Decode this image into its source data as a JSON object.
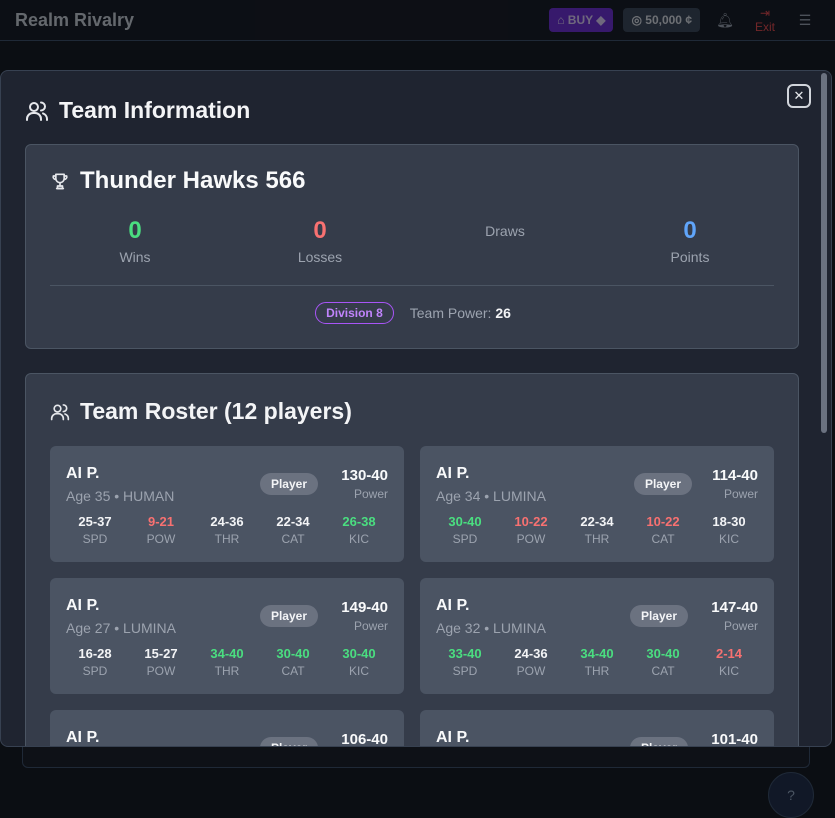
{
  "app": {
    "title": "Realm Rivalry",
    "buy_label": "BUY",
    "coins": "50,000",
    "exit_label": "Exit"
  },
  "modal": {
    "title": "Team Information",
    "close_icon": "close-icon"
  },
  "team": {
    "name": "Thunder Hawks 566",
    "stats": [
      {
        "value": "0",
        "label": "Wins",
        "color": "#4ade80"
      },
      {
        "value": "0",
        "label": "Losses",
        "color": "#f87171"
      },
      {
        "value": "",
        "label": "Draws",
        "color": "#9ca3af"
      },
      {
        "value": "0",
        "label": "Points",
        "color": "#60a5fa"
      }
    ],
    "division": "Division 8",
    "team_power_label": "Team Power:",
    "team_power_value": "26"
  },
  "roster": {
    "title": "Team Roster (12 players)",
    "stat_labels": [
      "SPD",
      "POW",
      "THR",
      "CAT",
      "KIC"
    ],
    "players": [
      {
        "name": "AI P.",
        "sub": "Age 35 • HUMAN",
        "tag": "Player",
        "rating": "130-40",
        "power_label": "Power",
        "stats": [
          [
            "25-37",
            "white"
          ],
          [
            "9-21",
            "red"
          ],
          [
            "24-36",
            "white"
          ],
          [
            "22-34",
            "white"
          ],
          [
            "26-38",
            "green"
          ]
        ]
      },
      {
        "name": "AI P.",
        "sub": "Age 34 • LUMINA",
        "tag": "Player",
        "rating": "114-40",
        "power_label": "Power",
        "stats": [
          [
            "30-40",
            "green"
          ],
          [
            "10-22",
            "red"
          ],
          [
            "22-34",
            "white"
          ],
          [
            "10-22",
            "red"
          ],
          [
            "18-30",
            "white"
          ]
        ]
      },
      {
        "name": "AI P.",
        "sub": "Age 27 • LUMINA",
        "tag": "Player",
        "rating": "149-40",
        "power_label": "Power",
        "stats": [
          [
            "16-28",
            "white"
          ],
          [
            "15-27",
            "white"
          ],
          [
            "34-40",
            "green"
          ],
          [
            "30-40",
            "green"
          ],
          [
            "30-40",
            "green"
          ]
        ]
      },
      {
        "name": "AI P.",
        "sub": "Age 32 • LUMINA",
        "tag": "Player",
        "rating": "147-40",
        "power_label": "Power",
        "stats": [
          [
            "33-40",
            "green"
          ],
          [
            "24-36",
            "white"
          ],
          [
            "34-40",
            "green"
          ],
          [
            "30-40",
            "green"
          ],
          [
            "2-14",
            "red"
          ]
        ]
      },
      {
        "name": "AI P.",
        "sub": "",
        "tag": "Player",
        "rating": "106-40",
        "power_label": "",
        "stats": []
      },
      {
        "name": "AI P.",
        "sub": "",
        "tag": "Player",
        "rating": "101-40",
        "power_label": "",
        "stats": []
      }
    ]
  }
}
